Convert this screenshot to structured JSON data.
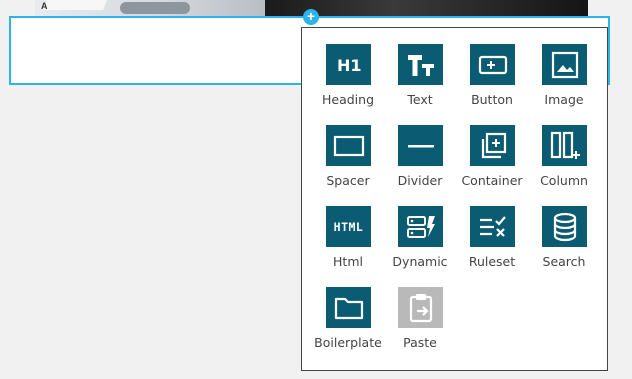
{
  "canvas": {
    "add_button_symbol": "+"
  },
  "palette": {
    "items": [
      {
        "label": "Heading",
        "icon": "heading-h1-icon"
      },
      {
        "label": "Text",
        "icon": "text-icon"
      },
      {
        "label": "Button",
        "icon": "button-icon"
      },
      {
        "label": "Image",
        "icon": "image-icon"
      },
      {
        "label": "Spacer",
        "icon": "spacer-icon"
      },
      {
        "label": "Divider",
        "icon": "divider-icon"
      },
      {
        "label": "Container",
        "icon": "container-icon"
      },
      {
        "label": "Column",
        "icon": "column-icon"
      },
      {
        "label": "Html",
        "icon": "html-icon",
        "icon_text": "HTML"
      },
      {
        "label": "Dynamic",
        "icon": "dynamic-icon"
      },
      {
        "label": "Ruleset",
        "icon": "ruleset-icon"
      },
      {
        "label": "Search",
        "icon": "search-database-icon"
      },
      {
        "label": "Boilerplate",
        "icon": "folder-icon"
      },
      {
        "label": "Paste",
        "icon": "paste-icon",
        "disabled": true
      }
    ]
  },
  "colors": {
    "accent": "#2bb3ea",
    "icon_tile": "#0b5c73",
    "icon_tile_disabled": "#b9b9b9",
    "label_text": "#444444"
  }
}
